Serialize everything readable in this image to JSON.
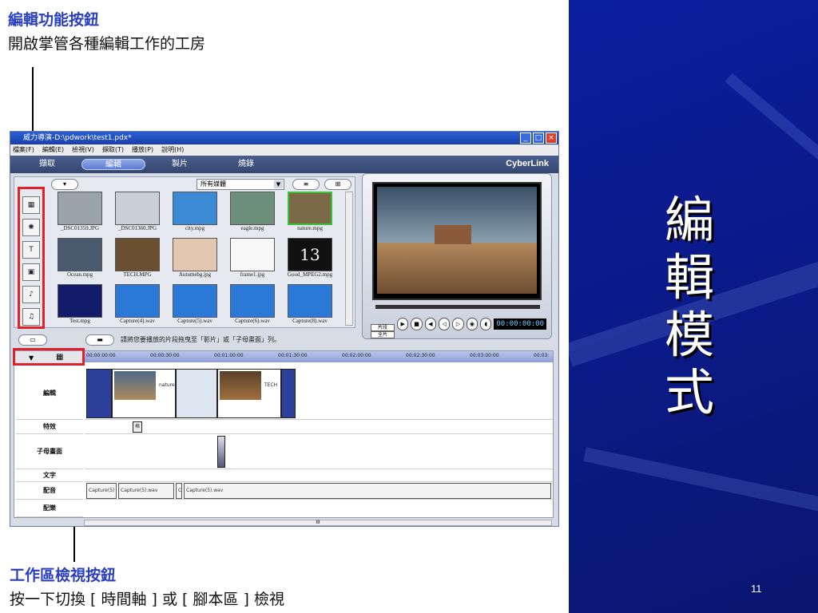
{
  "annotations": {
    "top_title": "編輯功能按鈕",
    "top_sub": "開啟掌管各種編輯工作的工房",
    "bottom_title": "工作區檢視按鈕",
    "bottom_sub": "按一下切換 [ 時間軸 ] 或 [ 腳本區 ] 檢視"
  },
  "slide": {
    "title": "編輯模式",
    "page": "11"
  },
  "app": {
    "window_title": "威力導演-D:\\pdwork\\test1.pdx*",
    "menu": [
      "檔案(F)",
      "編輯(E)",
      "檢視(V)",
      "擷取(T)",
      "播放(P)",
      "說明(H)"
    ],
    "tabs": [
      "擷取",
      "編輯",
      "製片",
      "燒錄"
    ],
    "active_tab": 1,
    "brand": "CyberLink",
    "media_filter": "所有媒體",
    "thumbs": [
      {
        "label": "_DSC01359.JPG",
        "color": "#9aa3a8"
      },
      {
        "label": "_DSC01360.JPG",
        "color": "#c8d0d6"
      },
      {
        "label": "city.mpg",
        "color": "#3a8ad6"
      },
      {
        "label": "eagle.mpg",
        "color": "#6c8f7a"
      },
      {
        "label": "nature.mpg",
        "color": "#7a6a48"
      },
      {
        "label": "Ocean.mpg",
        "color": "#4a5a6e"
      },
      {
        "label": "TECH.MPG",
        "color": "#6a5030"
      },
      {
        "label": "Autumebg.jpg",
        "color": "#e2c6b0"
      },
      {
        "label": "frame1.jpg",
        "color": "#f8f8f8"
      },
      {
        "label": "Good_MPEG2.mpg",
        "color": "#101010"
      },
      {
        "label": "Test.mpg",
        "color": "#121a6a"
      },
      {
        "label": "Capture(4).wav",
        "color": "#2a78d8"
      },
      {
        "label": "Capture(5).wav",
        "color": "#2a78d8"
      },
      {
        "label": "Capture(6).wav",
        "color": "#2a78d8"
      },
      {
        "label": "Capture(8).wav",
        "color": "#2a78d8"
      }
    ],
    "thirteen": "13",
    "clip_label_1": "片段",
    "clip_label_2": "全片",
    "timecode": "00:00:00:00",
    "hint": "請將您要播放的片段拖曳至「影片」或「子母畫面」列。",
    "ruler_marks": [
      "00:00:00:00",
      "00:00:30:00",
      "00:01:00:00",
      "00:01:30:00",
      "00:02:00:00",
      "00:02:30:00",
      "00:03:00:00",
      "00:03:"
    ],
    "tracks": [
      "編輯",
      "特效",
      "子母畫面",
      "文字",
      "配音",
      "配樂"
    ],
    "clip_text_nature": "nature",
    "clip_text_tech": "TECH",
    "effect_label": "格",
    "audio_clips": [
      "Capture(5)",
      "Capture(5).wav",
      "C",
      "Capture(5).wav"
    ],
    "scroll_mark": "III"
  }
}
